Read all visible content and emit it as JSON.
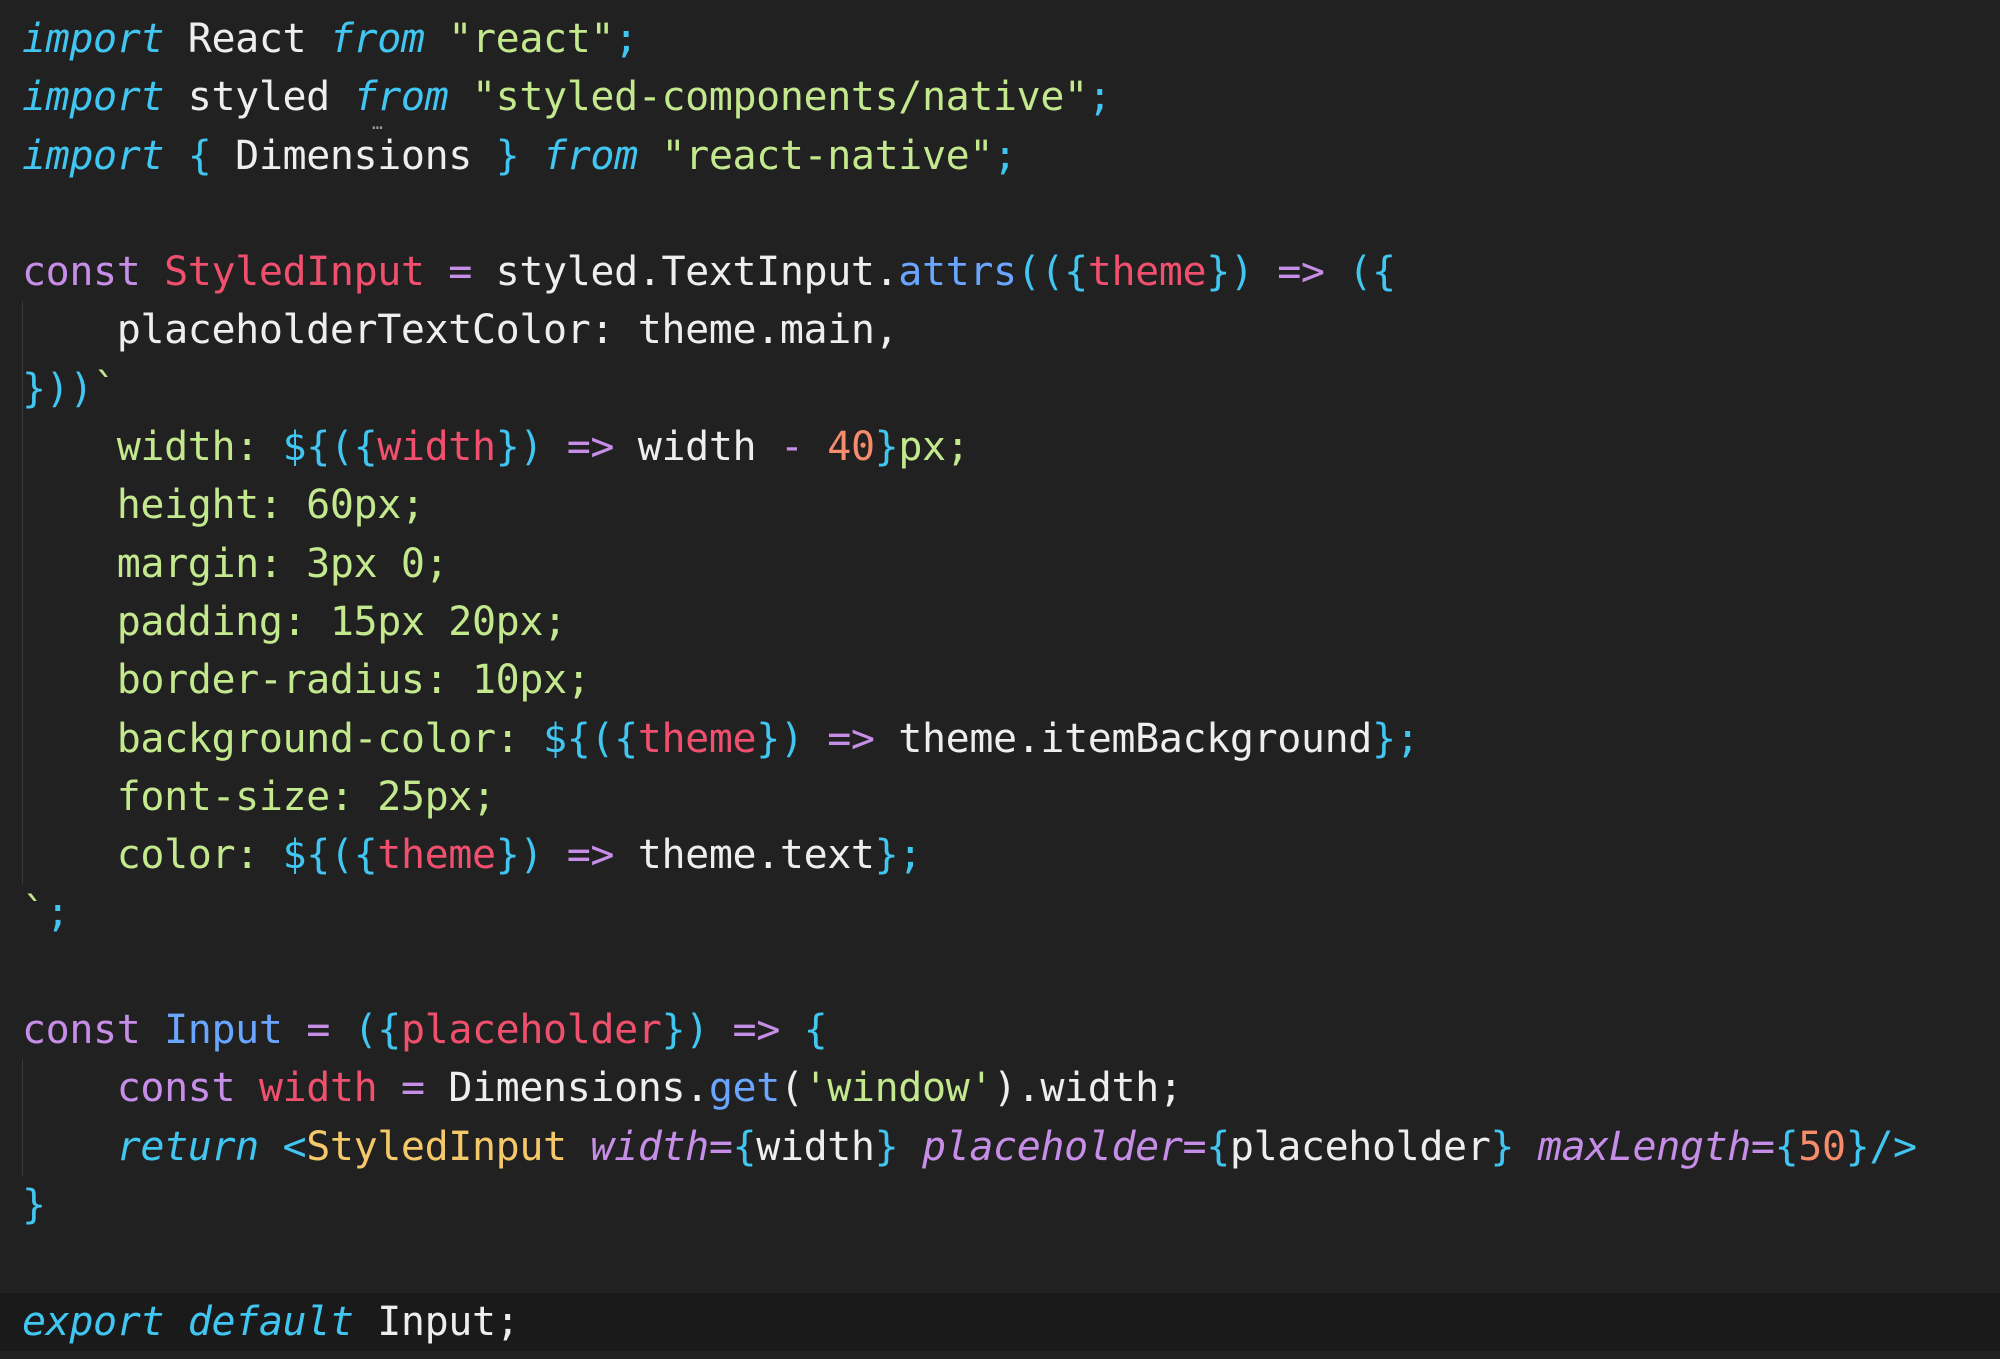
{
  "editor": {
    "theme_colors": {
      "background": "#212121",
      "keyword_italic": "#41c6f2",
      "storage": "#c78ee8",
      "string": "#c3e88d",
      "variable_definition": "#f0506e",
      "number": "#f78c6c",
      "function": "#6aa6ff",
      "jsx_tag": "#f5c96a"
    },
    "lines": [
      [
        {
          "t": "import",
          "c": "t-kw-it"
        },
        {
          "t": " React ",
          "c": "t-ident"
        },
        {
          "t": "from",
          "c": "t-kw-it"
        },
        {
          "t": " ",
          "c": "t-ident"
        },
        {
          "t": "\"react\"",
          "c": "t-str"
        },
        {
          "t": ";",
          "c": "t-punc"
        }
      ],
      [
        {
          "t": "import",
          "c": "t-kw-it"
        },
        {
          "t": " styled ",
          "c": "t-ident"
        },
        {
          "t": "from",
          "c": "t-kw-it"
        },
        {
          "t": " ",
          "c": "t-ident"
        },
        {
          "t": "\"styled-components/native\"",
          "c": "t-str"
        },
        {
          "t": ";",
          "c": "t-punc"
        }
      ],
      [
        {
          "t": "import",
          "c": "t-kw-it"
        },
        {
          "t": " ",
          "c": "t-ident"
        },
        {
          "t": "{",
          "c": "t-punc"
        },
        {
          "t": " Dimensions ",
          "c": "t-ident"
        },
        {
          "t": "}",
          "c": "t-punc"
        },
        {
          "t": " ",
          "c": "t-ident"
        },
        {
          "t": "from",
          "c": "t-kw-it"
        },
        {
          "t": " ",
          "c": "t-ident"
        },
        {
          "t": "\"react-native\"",
          "c": "t-str"
        },
        {
          "t": ";",
          "c": "t-punc"
        }
      ],
      [],
      [
        {
          "t": "const",
          "c": "t-storage"
        },
        {
          "t": " ",
          "c": "t-ident"
        },
        {
          "t": "StyledInput",
          "c": "t-var-def"
        },
        {
          "t": " = ",
          "c": "t-op"
        },
        {
          "t": "styled.TextInput.",
          "c": "t-ident"
        },
        {
          "t": "attrs",
          "c": "t-fn"
        },
        {
          "t": "((",
          "c": "t-punc"
        },
        {
          "t": "{",
          "c": "t-punc"
        },
        {
          "t": "theme",
          "c": "t-param"
        },
        {
          "t": "})",
          "c": "t-punc"
        },
        {
          "t": " => ",
          "c": "t-op"
        },
        {
          "t": "({",
          "c": "t-punc"
        }
      ],
      [
        {
          "t": "    placeholderTextColor: theme.main,",
          "c": "t-ident"
        }
      ],
      [
        {
          "t": "}))",
          "c": "t-punc"
        },
        {
          "t": "`",
          "c": "t-tpl"
        }
      ],
      [
        {
          "t": "    width: ",
          "c": "t-css"
        },
        {
          "t": "${",
          "c": "t-punc"
        },
        {
          "t": "({",
          "c": "t-punc"
        },
        {
          "t": "width",
          "c": "t-param"
        },
        {
          "t": "})",
          "c": "t-punc"
        },
        {
          "t": " => ",
          "c": "t-op"
        },
        {
          "t": "width ",
          "c": "t-ident"
        },
        {
          "t": "-",
          "c": "t-op"
        },
        {
          "t": " ",
          "c": "t-ident"
        },
        {
          "t": "40",
          "c": "t-num"
        },
        {
          "t": "}",
          "c": "t-punc"
        },
        {
          "t": "px;",
          "c": "t-css"
        }
      ],
      [
        {
          "t": "    height: 60px;",
          "c": "t-css"
        }
      ],
      [
        {
          "t": "    margin: 3px 0;",
          "c": "t-css"
        }
      ],
      [
        {
          "t": "    padding: 15px 20px;",
          "c": "t-css"
        }
      ],
      [
        {
          "t": "    border-radius: 10px;",
          "c": "t-css"
        }
      ],
      [
        {
          "t": "    background-color: ",
          "c": "t-css"
        },
        {
          "t": "${",
          "c": "t-punc"
        },
        {
          "t": "({",
          "c": "t-punc"
        },
        {
          "t": "theme",
          "c": "t-param"
        },
        {
          "t": "})",
          "c": "t-punc"
        },
        {
          "t": " => ",
          "c": "t-op"
        },
        {
          "t": "theme.itemBackground",
          "c": "t-ident"
        },
        {
          "t": "};",
          "c": "t-punc"
        }
      ],
      [
        {
          "t": "    font-size: 25px;",
          "c": "t-css"
        }
      ],
      [
        {
          "t": "    color: ",
          "c": "t-css"
        },
        {
          "t": "${",
          "c": "t-punc"
        },
        {
          "t": "({",
          "c": "t-punc"
        },
        {
          "t": "theme",
          "c": "t-param"
        },
        {
          "t": "})",
          "c": "t-punc"
        },
        {
          "t": " => ",
          "c": "t-op"
        },
        {
          "t": "theme.text",
          "c": "t-ident"
        },
        {
          "t": "};",
          "c": "t-punc"
        }
      ],
      [
        {
          "t": "`",
          "c": "t-tpl"
        },
        {
          "t": ";",
          "c": "t-punc"
        }
      ],
      [],
      [
        {
          "t": "const",
          "c": "t-storage"
        },
        {
          "t": " ",
          "c": "t-ident"
        },
        {
          "t": "Input",
          "c": "t-fn"
        },
        {
          "t": " = ",
          "c": "t-op"
        },
        {
          "t": "({",
          "c": "t-punc"
        },
        {
          "t": "placeholder",
          "c": "t-param"
        },
        {
          "t": "})",
          "c": "t-punc"
        },
        {
          "t": " => ",
          "c": "t-op"
        },
        {
          "t": "{",
          "c": "t-punc"
        }
      ],
      [
        {
          "t": "    ",
          "c": "t-ident"
        },
        {
          "t": "const",
          "c": "t-storage"
        },
        {
          "t": " ",
          "c": "t-ident"
        },
        {
          "t": "width",
          "c": "t-var-def"
        },
        {
          "t": " = ",
          "c": "t-op"
        },
        {
          "t": "Dimensions.",
          "c": "t-ident"
        },
        {
          "t": "get",
          "c": "t-fn"
        },
        {
          "t": "(",
          "c": "t-ident"
        },
        {
          "t": "'window'",
          "c": "t-str"
        },
        {
          "t": ").width;",
          "c": "t-ident"
        }
      ],
      [
        {
          "t": "    ",
          "c": "t-ident"
        },
        {
          "t": "return",
          "c": "t-kw-it"
        },
        {
          "t": " <",
          "c": "t-punc"
        },
        {
          "t": "StyledInput",
          "c": "t-tag"
        },
        {
          "t": " ",
          "c": "t-ident"
        },
        {
          "t": "width",
          "c": "t-attr"
        },
        {
          "t": "=",
          "c": "t-op"
        },
        {
          "t": "{",
          "c": "t-punc"
        },
        {
          "t": "width",
          "c": "t-ident"
        },
        {
          "t": "}",
          "c": "t-punc"
        },
        {
          "t": " ",
          "c": "t-ident"
        },
        {
          "t": "placeholder",
          "c": "t-attr"
        },
        {
          "t": "=",
          "c": "t-op"
        },
        {
          "t": "{",
          "c": "t-punc"
        },
        {
          "t": "placeholder",
          "c": "t-ident"
        },
        {
          "t": "}",
          "c": "t-punc"
        },
        {
          "t": " ",
          "c": "t-ident"
        },
        {
          "t": "maxLength",
          "c": "t-attr"
        },
        {
          "t": "=",
          "c": "t-op"
        },
        {
          "t": "{",
          "c": "t-punc"
        },
        {
          "t": "50",
          "c": "t-num"
        },
        {
          "t": "}",
          "c": "t-punc"
        },
        {
          "t": "/>",
          "c": "t-punc"
        }
      ],
      [
        {
          "t": "}",
          "c": "t-punc"
        }
      ],
      [],
      [
        {
          "t": "export",
          "c": "t-kw-it"
        },
        {
          "t": " ",
          "c": "t-ident"
        },
        {
          "t": "default",
          "c": "t-kw-it"
        },
        {
          "t": " Input;",
          "c": "t-ident"
        }
      ]
    ],
    "current_line": 22,
    "guide_lines": [
      5,
      6,
      7,
      8,
      9,
      10,
      11,
      12,
      13,
      14,
      18,
      19
    ]
  }
}
